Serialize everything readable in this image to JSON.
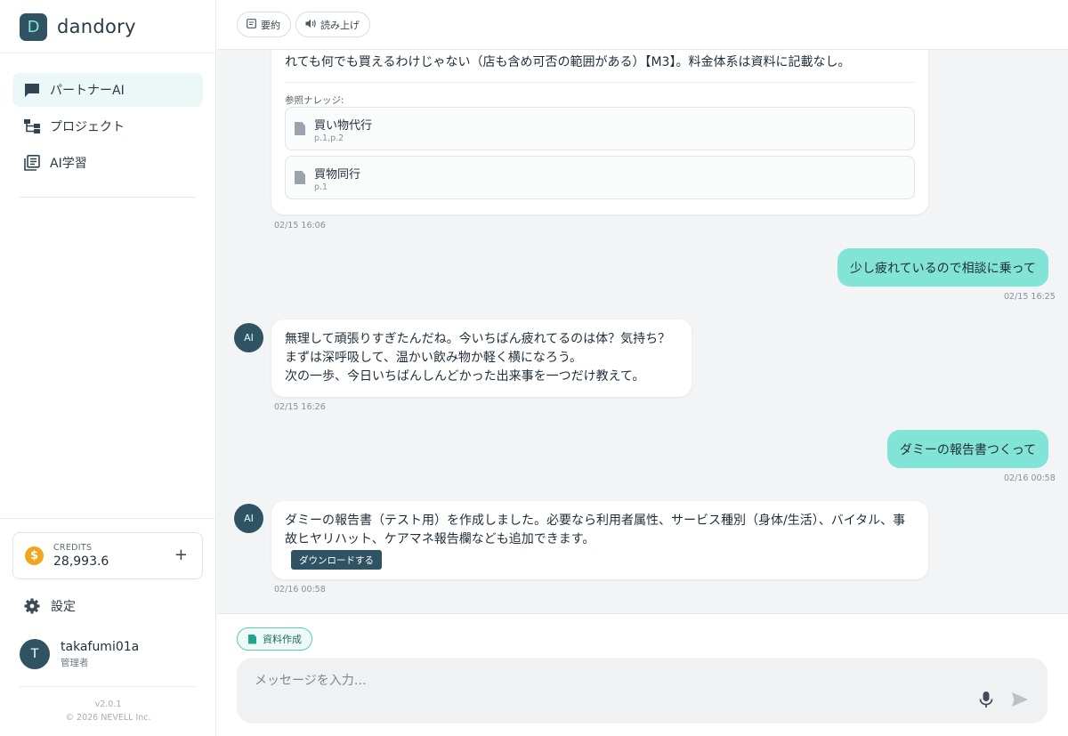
{
  "brand": {
    "logo_letter": "D",
    "name": "dandory"
  },
  "nav": {
    "items": [
      {
        "label": "パートナーAI",
        "icon": "chat-icon",
        "active": true
      },
      {
        "label": "プロジェクト",
        "icon": "project-tree-icon",
        "active": false
      },
      {
        "label": "AI学習",
        "icon": "library-icon",
        "active": false
      }
    ]
  },
  "credits": {
    "label": "CREDITS",
    "value": "28,993.6",
    "coin_symbol": "$",
    "add_symbol": "+"
  },
  "settings": {
    "label": "設定"
  },
  "user": {
    "initial": "T",
    "name": "takafumi01a",
    "role": "管理者"
  },
  "footer": {
    "version": "v2.0.1",
    "copyright": "© 2026 NEVELL Inc."
  },
  "toolbar": {
    "summary_label": "要約",
    "read_aloud_label": "読み上げ"
  },
  "messages": {
    "m1": {
      "text": "れても何でも買えるわけじゃない（店も含め可否の範囲がある）【M3】。料金体系は資料に記載なし。",
      "refs_label": "参照ナレッジ:",
      "refs": [
        {
          "title": "買い物代行",
          "pages": "p.1,p.2"
        },
        {
          "title": "買物同行",
          "pages": "p.1"
        }
      ],
      "time": "02/15 16:06"
    },
    "m2": {
      "text": "少し疲れているので相談に乗って",
      "time": "02/15 16:25"
    },
    "m3": {
      "avatar": "AI",
      "lines": [
        "無理して頑張りすぎたんだね。今いちばん疲れてるのは体？気持ち？",
        "まずは深呼吸して、温かい飲み物か軽く横になろう。",
        "次の一歩、今日いちばんしんどかった出来事を一つだけ教えて。"
      ],
      "time": "02/15 16:26"
    },
    "m4": {
      "text": "ダミーの報告書つくって",
      "time": "02/16 00:58"
    },
    "m5": {
      "avatar": "AI",
      "lines": [
        "ダミーの報告書（テスト用）を作成しました。必要なら利用者属性、サービス種別（身体/生活）、バイタル、事",
        "故ヒヤリハット、ケアマネ報告欄なども追加できます。"
      ],
      "download_label": "ダウンロードする",
      "time": "02/16 00:58"
    }
  },
  "composer": {
    "chip_label": "資料作成",
    "placeholder": "メッセージを入力…",
    "value": ""
  },
  "colors": {
    "accent": "#82e4d6",
    "brand_dark": "#2f5363",
    "coin": "#f2a51f"
  }
}
